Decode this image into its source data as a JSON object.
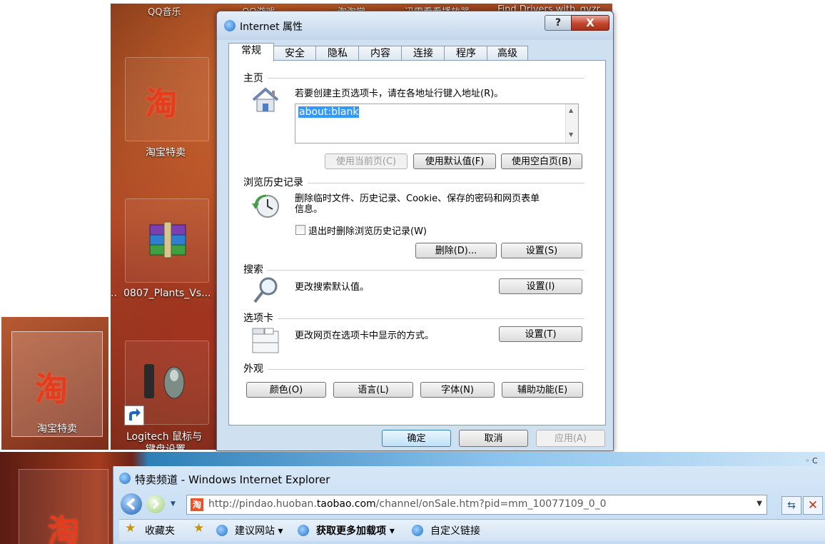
{
  "desktop": {
    "top_labels": [
      "QQ音乐",
      "QQ游戏",
      "淘淘堂",
      "迅雷看看播放器",
      "Find Drivers with_qyzr"
    ],
    "icons": [
      {
        "name": "taobao",
        "logo": "淘",
        "label": "淘宝特卖"
      },
      {
        "name": "winrar",
        "label": "0807_Plants_Vs..."
      },
      {
        "name": "logitech",
        "label_line1": "Logitech 鼠标与",
        "label_line2": "键盘设置"
      }
    ],
    "left_tile": {
      "logo": "淘",
      "label": "淘宝特卖"
    },
    "truncated_mark": ".."
  },
  "dialog": {
    "title": "Internet 属性",
    "help_label": "?",
    "close_label": "X",
    "tabs": [
      "常规",
      "安全",
      "隐私",
      "内容",
      "连接",
      "程序",
      "高级"
    ],
    "active_tab": 0,
    "home": {
      "title": "主页",
      "instruction": "若要创建主页选项卡，请在各地址行键入地址(R)。",
      "address_value": "about:blank",
      "btn_current": "使用当前页(C)",
      "btn_default": "使用默认值(F)",
      "btn_blank": "使用空白页(B)"
    },
    "history": {
      "title": "浏览历史记录",
      "desc_line1": "删除临时文件、历史记录、Cookie、保存的密码和网页表单",
      "desc_line2": "信息。",
      "checkbox_label": "退出时删除浏览历史记录(W)",
      "btn_delete": "删除(D)...",
      "btn_settings": "设置(S)"
    },
    "search": {
      "title": "搜索",
      "desc": "更改搜索默认值。",
      "btn_settings": "设置(I)"
    },
    "tabs_section": {
      "title": "选项卡",
      "desc": "更改网页在选项卡中显示的方式。",
      "btn_settings": "设置(T)"
    },
    "appearance": {
      "title": "外观",
      "btn_colors": "颜色(O)",
      "btn_languages": "语言(L)",
      "btn_fonts": "字体(N)",
      "btn_accessibility": "辅助功能(E)"
    },
    "footer": {
      "ok": "确定",
      "cancel": "取消",
      "apply": "应用(A)"
    }
  },
  "browser": {
    "title": "特卖频道 - Windows Internet Explorer",
    "url_prefix": "http://pindao.huoban.",
    "url_domain": "taobao.com",
    "url_suffix": "/channel/onSale.htm?pid=mm_10077109_0_0",
    "favorites_label": "收藏夹",
    "links": [
      "建议网站 ▾",
      "获取更多加载项 ▾",
      "自定义链接"
    ],
    "corner_label": "◦ C"
  }
}
